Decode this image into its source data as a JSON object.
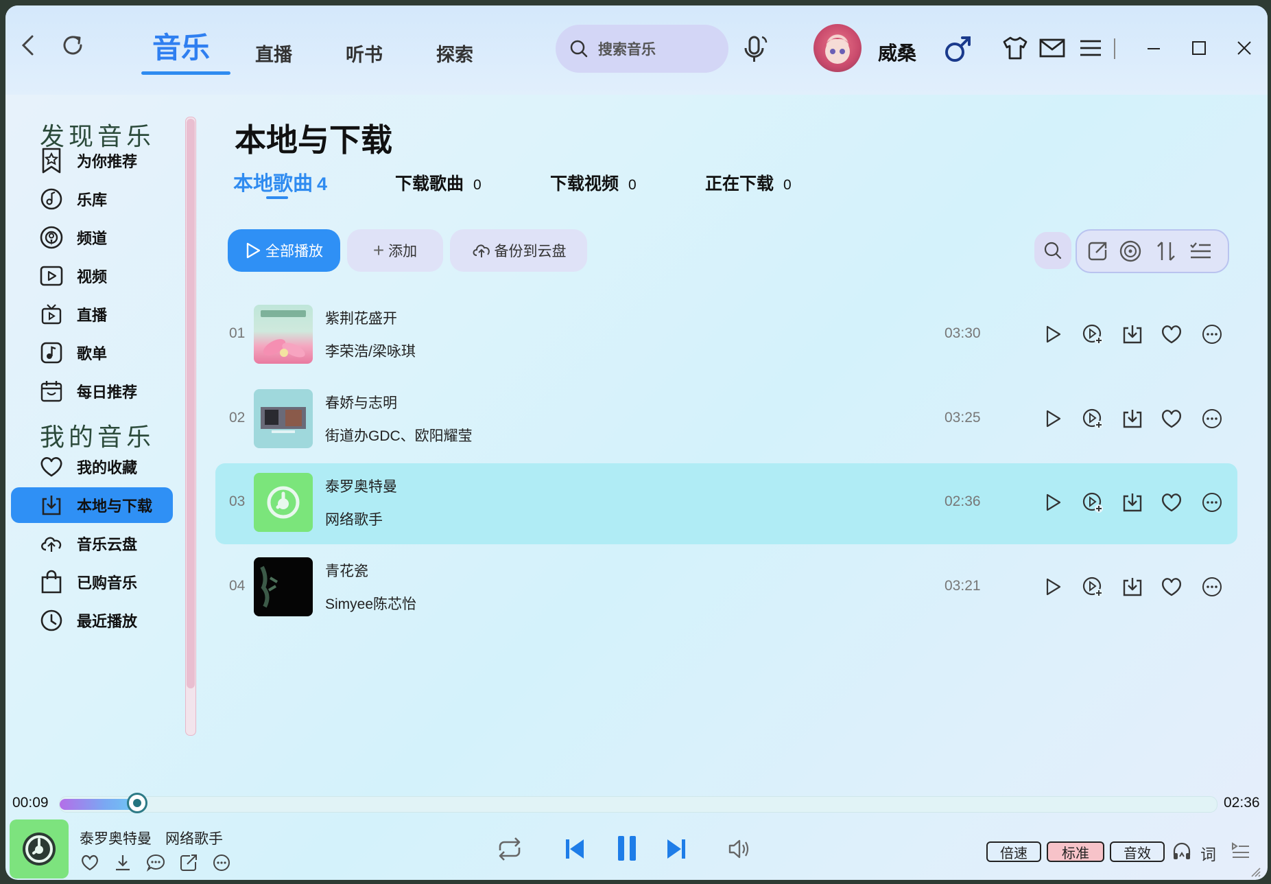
{
  "colors": {
    "accent": "#2f90f5",
    "highlight_row": "#b0ecf5",
    "pill_red": "#f7c3c9"
  },
  "top_nav": {
    "tabs": [
      {
        "label": "音乐",
        "active": true
      },
      {
        "label": "直播"
      },
      {
        "label": "听书"
      },
      {
        "label": "探索"
      }
    ],
    "search_placeholder": "搜索音乐",
    "username": "威桑"
  },
  "sidebar": {
    "discover_title": "发现音乐",
    "discover_items": [
      {
        "label": "为你推荐",
        "icon": "star-bookmark-icon"
      },
      {
        "label": "乐库",
        "icon": "disc-icon"
      },
      {
        "label": "频道",
        "icon": "podcast-icon"
      },
      {
        "label": "视频",
        "icon": "video-icon"
      },
      {
        "label": "直播",
        "icon": "tv-icon"
      },
      {
        "label": "歌单",
        "icon": "music-note-icon"
      },
      {
        "label": "每日推荐",
        "icon": "calendar-icon"
      }
    ],
    "mine_title": "我的音乐",
    "mine_items": [
      {
        "label": "我的收藏",
        "icon": "heart-icon"
      },
      {
        "label": "本地与下载",
        "icon": "download-icon",
        "active": true
      },
      {
        "label": "音乐云盘",
        "icon": "cloud-icon"
      },
      {
        "label": "已购音乐",
        "icon": "shopping-bag-icon"
      },
      {
        "label": "最近播放",
        "icon": "clock-icon"
      }
    ]
  },
  "main": {
    "title": "本地与下载",
    "subtabs": [
      {
        "label": "本地歌曲",
        "count": "4",
        "active": true
      },
      {
        "label": "下载歌曲",
        "count": "0"
      },
      {
        "label": "下载视频",
        "count": "0"
      },
      {
        "label": "正在下载",
        "count": "0"
      }
    ],
    "actions": {
      "play_all": "全部播放",
      "add": "添加",
      "backup": "备份到云盘"
    },
    "songs": [
      {
        "index": "01",
        "title": "紫荆花盛开",
        "artist": "李荣浩/梁咏琪",
        "duration": "03:30"
      },
      {
        "index": "02",
        "title": "春娇与志明",
        "artist": "街道办GDC、欧阳耀莹",
        "duration": "03:25"
      },
      {
        "index": "03",
        "title": "泰罗奥特曼",
        "artist": "网络歌手",
        "duration": "02:36",
        "playing": true
      },
      {
        "index": "04",
        "title": "青花瓷",
        "artist": "Simyee陈芯怡",
        "duration": "03:21"
      }
    ]
  },
  "player": {
    "elapsed": "00:09",
    "total": "02:36",
    "progress_fraction": 0.058,
    "now_title": "泰罗奥特曼",
    "now_artist": "网络歌手",
    "speed_label": "倍速",
    "quality_label": "标准",
    "effect_label": "音效",
    "lyrics_label": "词"
  }
}
